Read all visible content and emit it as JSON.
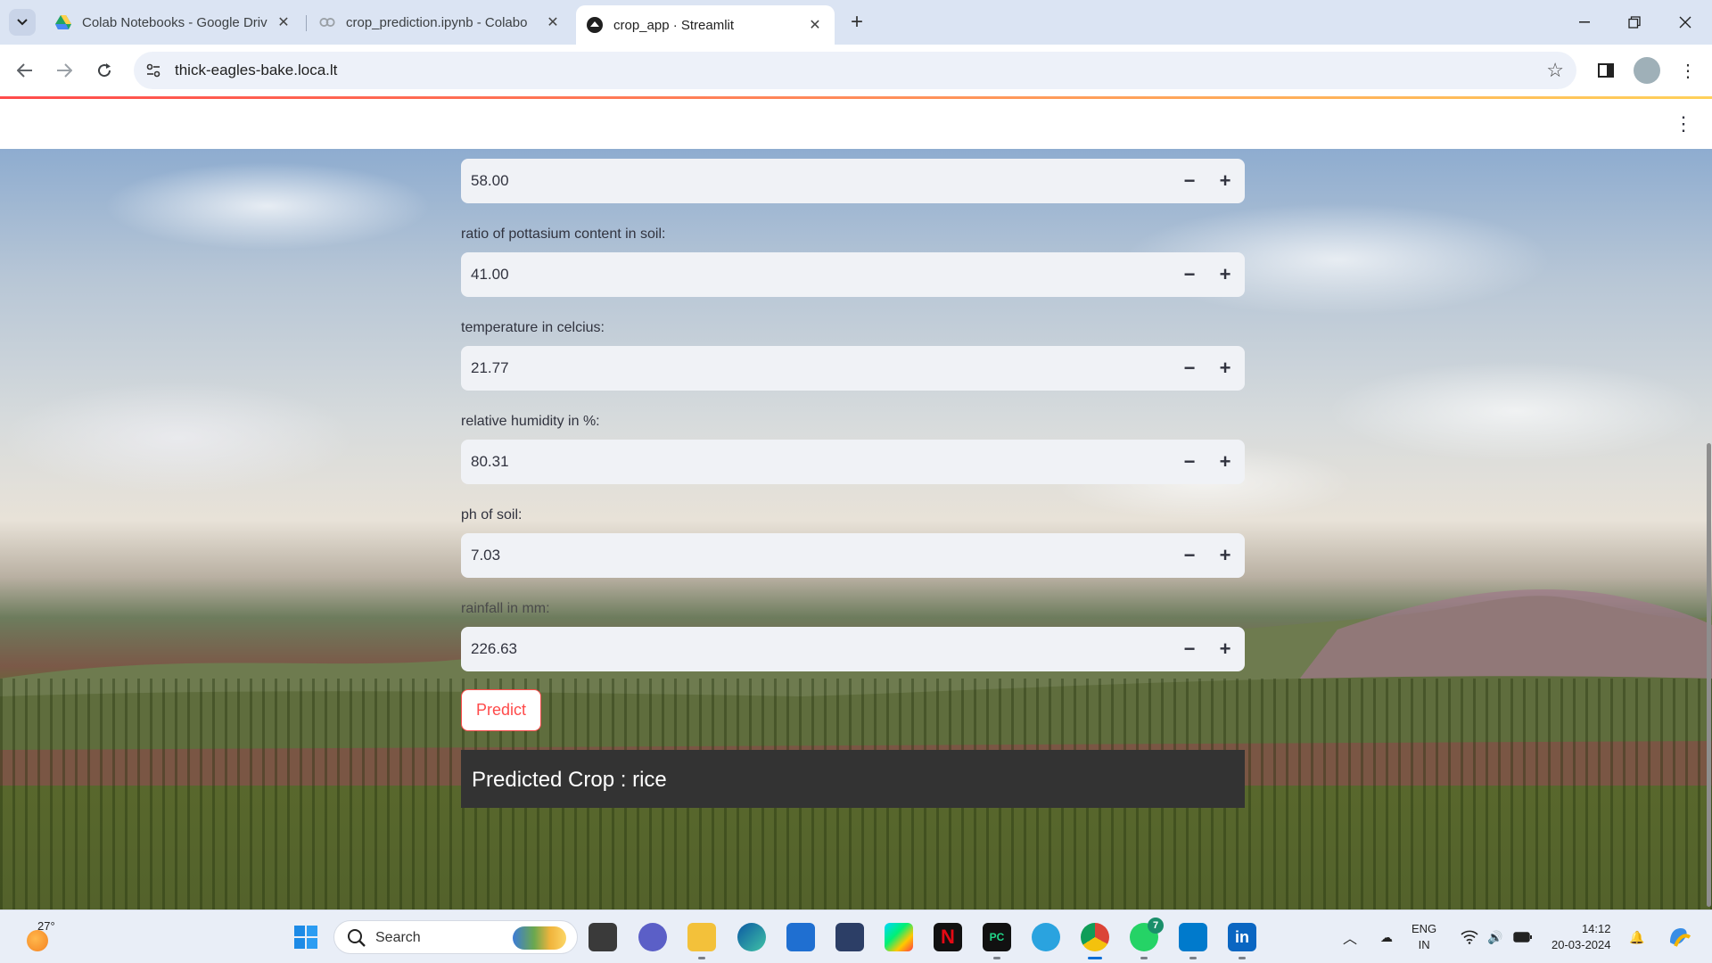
{
  "browser": {
    "tabs": [
      {
        "title": "Colab Notebooks - Google Driv",
        "icon": "google-drive-icon"
      },
      {
        "title": "crop_prediction.ipynb - Colabo",
        "icon": "colab-icon"
      },
      {
        "title": "crop_app · Streamlit",
        "icon": "streamlit-icon"
      }
    ],
    "url": "thick-eagles-bake.loca.lt"
  },
  "form": {
    "fields": [
      {
        "label": "",
        "value": "58.00"
      },
      {
        "label": "ratio of pottasium content in soil:",
        "value": "41.00"
      },
      {
        "label": "temperature in celcius:",
        "value": "21.77"
      },
      {
        "label": "relative humidity in %:",
        "value": "80.31"
      },
      {
        "label": "ph of soil:",
        "value": "7.03"
      },
      {
        "label": "rainfall in mm:",
        "value": "226.63"
      }
    ],
    "minus_symbol": "−",
    "plus_symbol": "+",
    "predict_label": "Predict",
    "result_text": "Predicted Crop : rice"
  },
  "colors": {
    "accent": "#ff4b4b",
    "result_bg": "#333333",
    "input_bg": "#f0f2f6"
  },
  "taskbar": {
    "weather_temp": "27°",
    "search_placeholder": "Search",
    "whatsapp_badge": "7",
    "lang_line1": "ENG",
    "lang_line2": "IN",
    "time": "14:12",
    "date": "20-03-2024"
  }
}
